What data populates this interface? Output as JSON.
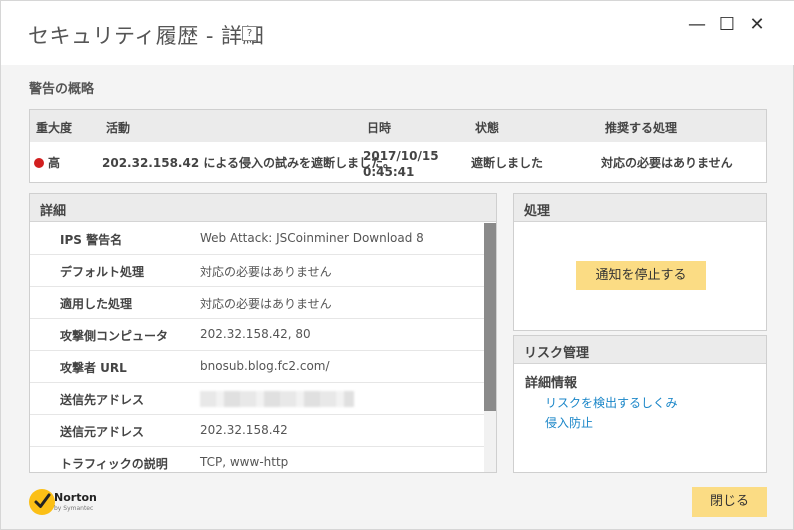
{
  "window": {
    "title": "セキュリティ履歴 - 詳細",
    "help_label": "?",
    "minimize_glyph": "—",
    "maximize_glyph": "☐",
    "close_glyph": "✕"
  },
  "summary": {
    "section_title": "警告の概略",
    "headers": [
      "重大度",
      "活動",
      "日時",
      "状態",
      "推奨する処理"
    ],
    "severity_color": "#d21f1f",
    "severity": "高",
    "activity": "202.32.158.42 による侵入の試みを遮断しました。",
    "date": "2017/10/15",
    "time": "0:45:41",
    "status": "遮断しました",
    "recommended": "対応の必要はありません"
  },
  "details": {
    "title": "詳細",
    "rows": [
      {
        "key": "IPS 警告名",
        "value": "Web Attack: JSCoinminer Download 8"
      },
      {
        "key": "デフォルト処理",
        "value": "対応の必要はありません"
      },
      {
        "key": "適用した処理",
        "value": "対応の必要はありません"
      },
      {
        "key": "攻撃側コンピュータ",
        "value": "202.32.158.42, 80"
      },
      {
        "key": "攻撃者 URL",
        "value": "bnosub.blog.fc2.com/"
      },
      {
        "key": "送信先アドレス",
        "value": ""
      },
      {
        "key": "送信元アドレス",
        "value": "202.32.158.42"
      },
      {
        "key": "トラフィックの説明",
        "value": "TCP, www-http"
      }
    ]
  },
  "action": {
    "title": "処理",
    "stop_button": "通知を停止する"
  },
  "risk": {
    "title": "リスク管理",
    "subtitle": "詳細情報",
    "links": [
      "リスクを検出するしくみ",
      "侵入防止"
    ]
  },
  "footer": {
    "logo_name": "Norton",
    "logo_by": "by Symantec",
    "close_button": "閉じる"
  },
  "colors": {
    "accent_button": "#fbdc84",
    "link": "#1a86c8"
  }
}
